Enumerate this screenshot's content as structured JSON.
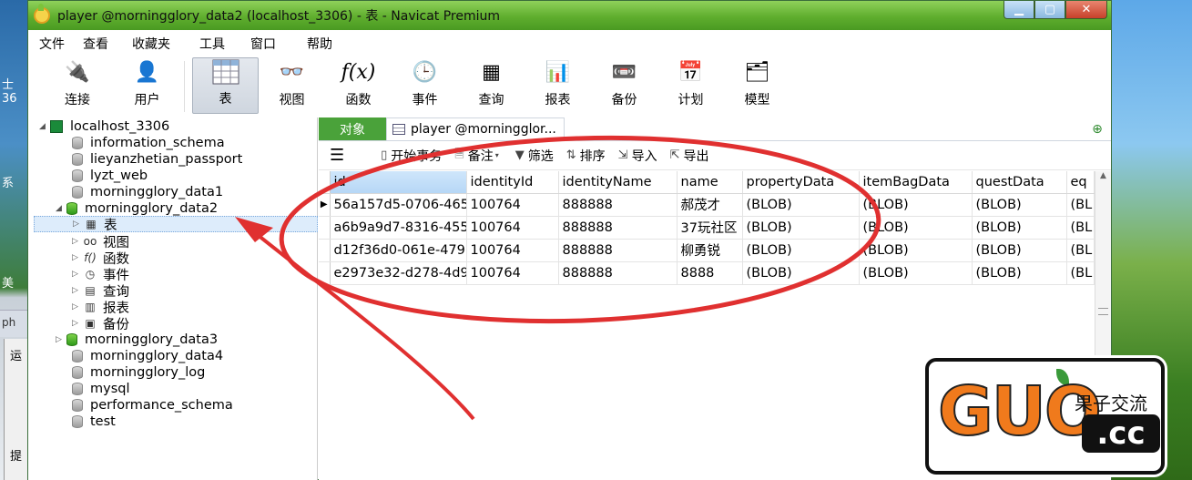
{
  "desktop": {
    "left_texts": [
      "士 36",
      "系",
      "美"
    ],
    "taskbar_label": "ph",
    "side_panel_labels": [
      "运",
      "提"
    ]
  },
  "window": {
    "title": "player @morningglory_data2 (localhost_3306) - 表 - Navicat Premium"
  },
  "menu": [
    "文件",
    "查看",
    "收藏夹",
    "工具",
    "窗口",
    "帮助"
  ],
  "toolbar": {
    "items": [
      {
        "label": "连接",
        "icon": "plug-icon"
      },
      {
        "label": "用户",
        "icon": "user-icon"
      },
      {
        "label": "表",
        "icon": "table-icon",
        "active": true
      },
      {
        "label": "视图",
        "icon": "glasses-view-icon"
      },
      {
        "label": "函数",
        "icon": "function-icon"
      },
      {
        "label": "事件",
        "icon": "event-icon"
      },
      {
        "label": "查询",
        "icon": "query-icon"
      },
      {
        "label": "报表",
        "icon": "report-icon"
      },
      {
        "label": "备份",
        "icon": "backup-icon"
      },
      {
        "label": "计划",
        "icon": "calendar-icon"
      },
      {
        "label": "模型",
        "icon": "model-icon"
      }
    ]
  },
  "tree": {
    "server": "localhost_3306",
    "databases_before": [
      "information_schema",
      "lieyanzhetian_passport",
      "lyzt_web",
      "morningglory_data1"
    ],
    "open_db": "morningglory_data2",
    "open_children": [
      "表",
      "视图",
      "函数",
      "事件",
      "查询",
      "报表",
      "备份"
    ],
    "databases_after": [
      "morningglory_data3",
      "morningglory_data4",
      "morningglory_log",
      "mysql",
      "performance_schema",
      "test"
    ]
  },
  "tabs": {
    "object": "对象",
    "player": "player @morningglor..."
  },
  "gridbar": {
    "begin_tx": "开始事务",
    "note": "备注",
    "filter": "筛选",
    "sort": "排序",
    "import": "导入",
    "export": "导出"
  },
  "grid": {
    "columns": [
      "id",
      "identityId",
      "identityName",
      "name",
      "propertyData",
      "itemBagData",
      "questData",
      "eq"
    ],
    "rows": [
      [
        "56a157d5-0706-465",
        "100764",
        "888888",
        "郝茂才",
        "(BLOB)",
        "(BLOB)",
        "(BLOB)",
        "(BL"
      ],
      [
        "a6b9a9d7-8316-455",
        "100764",
        "888888",
        "37玩社区",
        "(BLOB)",
        "(BLOB)",
        "(BLOB)",
        "(BL"
      ],
      [
        "d12f36d0-061e-479",
        "100764",
        "888888",
        "柳勇锐",
        "(BLOB)",
        "(BLOB)",
        "(BLOB)",
        "(BL"
      ],
      [
        "e2973e32-d278-4d9",
        "100764",
        "888888",
        "8888",
        "(BLOB)",
        "(BLOB)",
        "(BLOB)",
        "(BL"
      ]
    ]
  },
  "watermark": {
    "big": "GUO",
    "domain": ".cc",
    "cn": "果子交流"
  },
  "colors": {
    "title_green": "#5fae2e",
    "object_tab": "#4aa23a",
    "annotation_red": "#e03030",
    "watermark_orange": "#f07a1c"
  }
}
